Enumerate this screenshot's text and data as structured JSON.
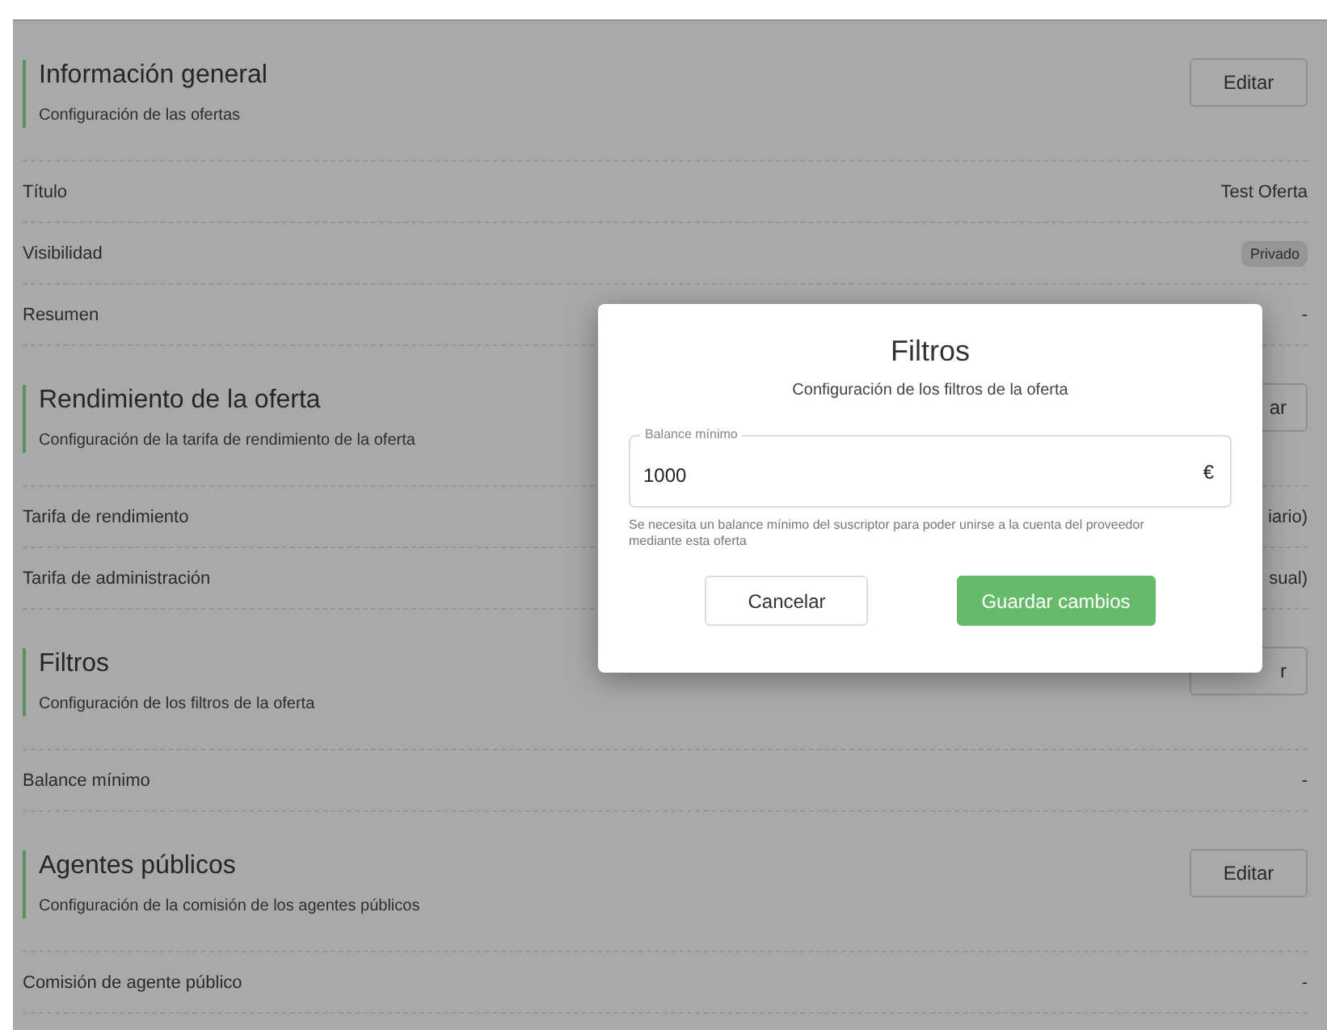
{
  "sections": [
    {
      "title": "Información general",
      "subtitle": "Configuración de las ofertas",
      "button": "Editar",
      "fields": [
        {
          "label": "Título",
          "value": "Test Oferta",
          "kind": "text"
        },
        {
          "label": "Visibilidad",
          "value": "Privado",
          "kind": "badge"
        },
        {
          "label": "Resumen",
          "value": "-",
          "kind": "text"
        }
      ]
    },
    {
      "title": "Rendimiento de la oferta",
      "subtitle": "Configuración de la tarifa de rendimiento de la oferta",
      "button": "ar",
      "fields": [
        {
          "label": "Tarifa de rendimiento",
          "value": "iario)",
          "kind": "text"
        },
        {
          "label": "Tarifa de administración",
          "value": "sual)",
          "kind": "text"
        }
      ]
    },
    {
      "title": "Filtros",
      "subtitle": "Configuración de los filtros de la oferta",
      "button": "r",
      "fields": [
        {
          "label": "Balance mínimo",
          "value": "-",
          "kind": "text"
        }
      ]
    },
    {
      "title": "Agentes públicos",
      "subtitle": "Configuración de la comisión de los agentes públicos",
      "button": "Editar",
      "fields": [
        {
          "label": "Comisión de agente público",
          "value": "-",
          "kind": "text"
        }
      ]
    }
  ],
  "dialog": {
    "title": "Filtros",
    "subtitle": "Configuración de los filtros de la oferta",
    "field": {
      "label": "Balance mínimo",
      "value": "1000",
      "suffix": "€"
    },
    "helper": "Se necesita un balance mínimo del suscriptor para poder unirse a la cuenta del proveedor mediante esta oferta",
    "buttons": [
      {
        "label": "Cancelar",
        "kind": "secondary"
      },
      {
        "label": "Guardar cambios",
        "kind": "primary"
      }
    ]
  }
}
